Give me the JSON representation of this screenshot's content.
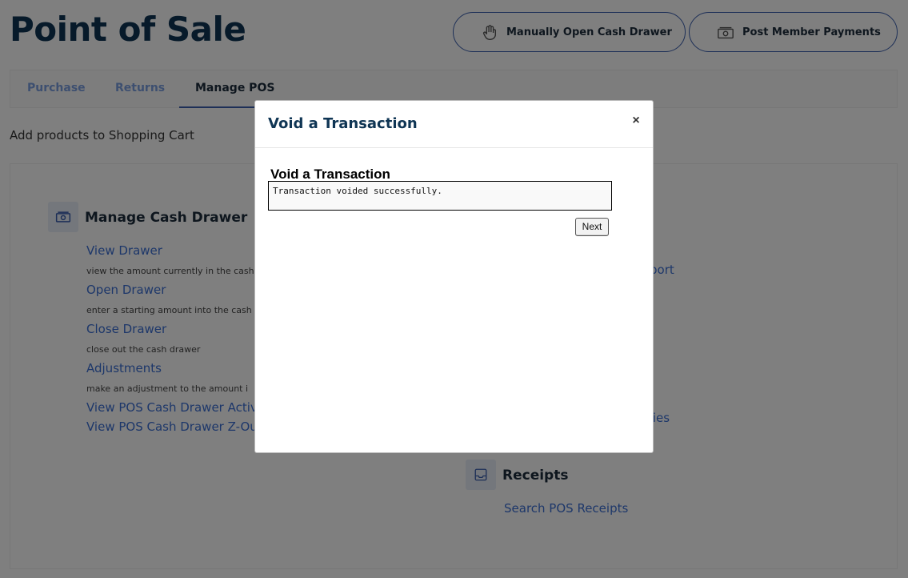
{
  "page": {
    "title": "Point of Sale",
    "subtitle": "Add products to Shopping Cart"
  },
  "header_buttons": {
    "open_drawer": {
      "label": "Manually Open Cash Drawer",
      "icon": "hand-icon"
    },
    "post_payments": {
      "label": "Post Member Payments",
      "icon": "cash-icon"
    }
  },
  "tabs": [
    {
      "label": "Purchase",
      "active": false
    },
    {
      "label": "Returns",
      "active": false
    },
    {
      "label": "Manage POS",
      "active": true
    }
  ],
  "cash_drawer": {
    "title": "Manage Cash Drawer",
    "icon": "cash-icon",
    "items": [
      {
        "link": "View Drawer",
        "desc": "view the amount currently in the cash"
      },
      {
        "link": "Open Drawer",
        "desc": "enter a starting amount into the cash"
      },
      {
        "link": "Close Drawer",
        "desc": "close out the cash drawer"
      },
      {
        "link": "Adjustments",
        "desc": "make an adjustment to the amount i"
      }
    ],
    "extra_links": [
      "View POS Cash Drawer Activit",
      "View POS Cash Drawer Z-Out"
    ]
  },
  "right_column": {
    "partial_link_1": "port",
    "partial_link_2": "ties"
  },
  "receipts": {
    "title": "Receipts",
    "icon": "inbox-icon",
    "link": "Search POS Receipts"
  },
  "modal": {
    "title": "Void a Transaction",
    "close": "×",
    "inner_title": "Void a Transaction",
    "message": "Transaction voided successfully.",
    "next": "Next"
  },
  "colors": {
    "brand": "#0f3554",
    "accent": "#3b5fae",
    "link": "#3b6fd4",
    "overlay": "rgba(0,0,0,0.5)"
  }
}
